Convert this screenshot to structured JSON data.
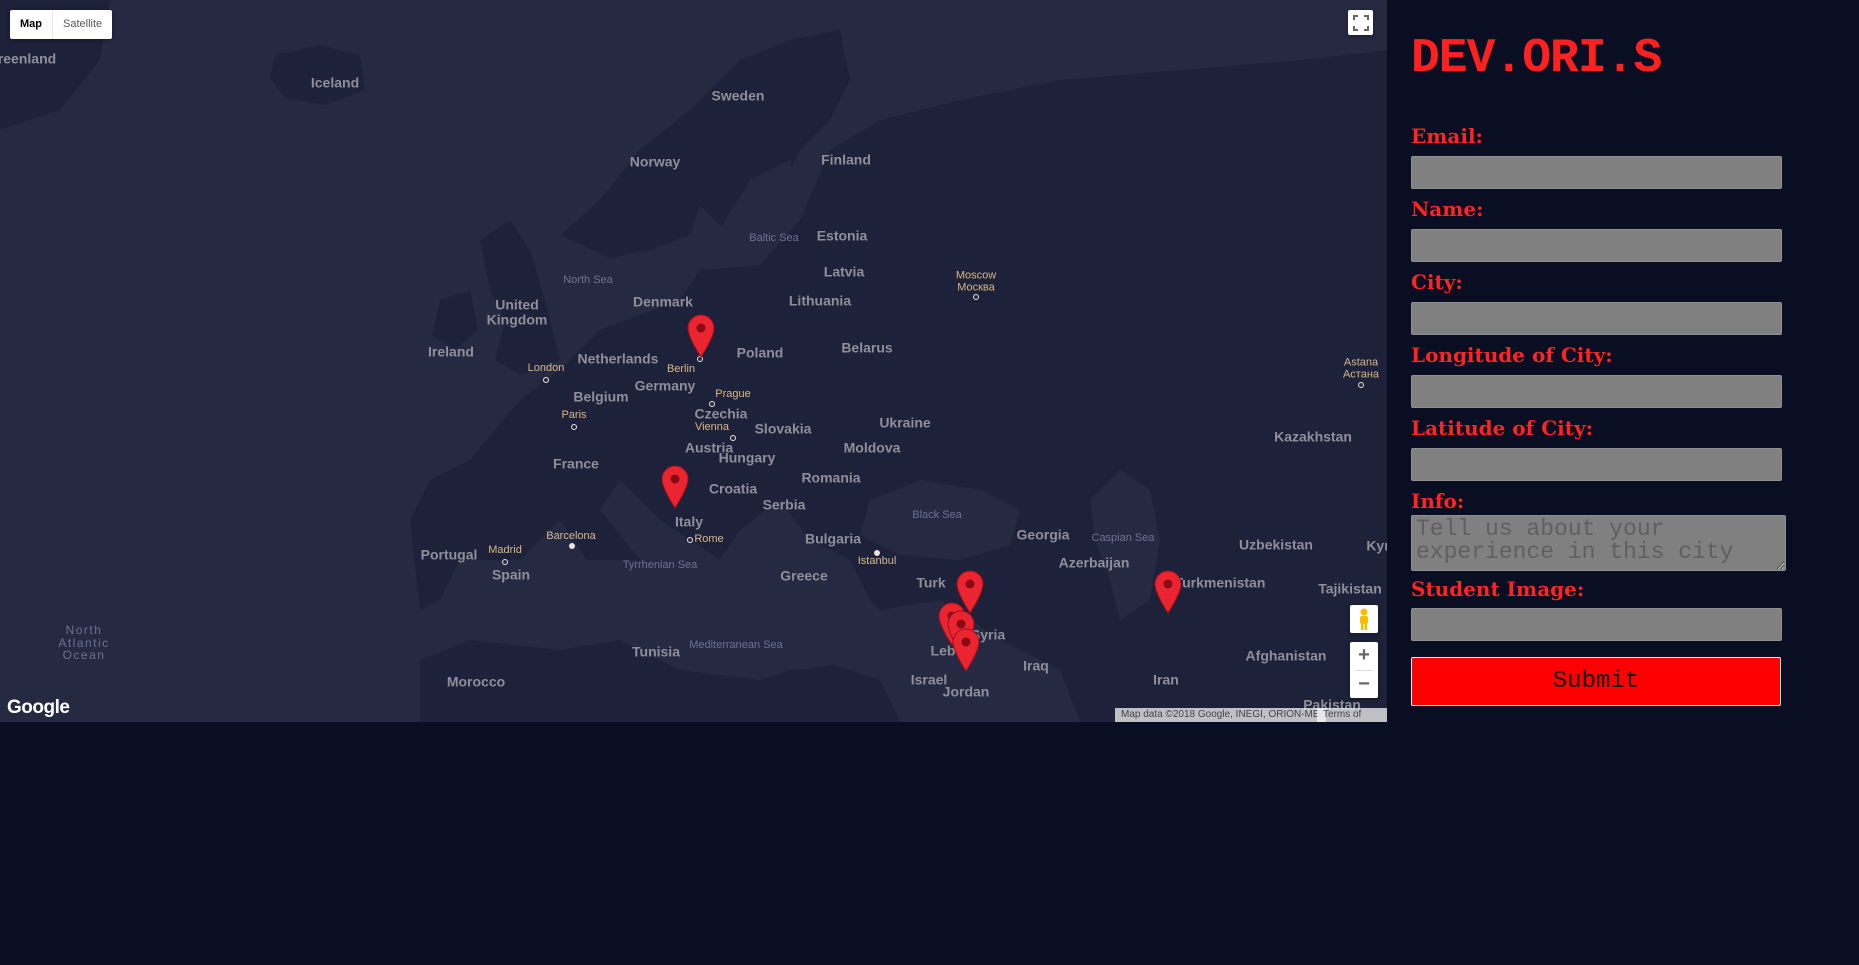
{
  "map": {
    "type_control": {
      "map_label": "Map",
      "satellite_label": "Satellite"
    },
    "fullscreen_icon": "fullscreen-icon",
    "pegman_icon": "pegman-icon",
    "zoom_in_label": "+",
    "zoom_out_label": "−",
    "logo": "Google",
    "attribution": "Map data ©2018 Google, INEGI, ORION-ME",
    "terms": "Terms of Use",
    "labels": [
      {
        "text": "reenland",
        "kind": "country"
      },
      {
        "text": "Iceland",
        "kind": "country"
      },
      {
        "text": "Sweden",
        "kind": "country"
      },
      {
        "text": "Norway",
        "kind": "country"
      },
      {
        "text": "Finland",
        "kind": "country"
      },
      {
        "text": "Baltic Sea",
        "kind": "sea"
      },
      {
        "text": "Estonia",
        "kind": "country"
      },
      {
        "text": "North Sea",
        "kind": "sea"
      },
      {
        "text": "Latvia",
        "kind": "country"
      },
      {
        "text": "Moscow\nМосква",
        "kind": "city"
      },
      {
        "text": "Denmark",
        "kind": "country"
      },
      {
        "text": "Lithuania",
        "kind": "country"
      },
      {
        "text": "United\nKingdom",
        "kind": "country"
      },
      {
        "text": "Ireland",
        "kind": "country"
      },
      {
        "text": "Belarus",
        "kind": "country"
      },
      {
        "text": "Netherlands",
        "kind": "country"
      },
      {
        "text": "Poland",
        "kind": "country"
      },
      {
        "text": "Berlin",
        "kind": "city"
      },
      {
        "text": "London",
        "kind": "city"
      },
      {
        "text": "Astana\nАстана",
        "kind": "city"
      },
      {
        "text": "Germany",
        "kind": "country"
      },
      {
        "text": "Belgium",
        "kind": "country"
      },
      {
        "text": "Prague",
        "kind": "city"
      },
      {
        "text": "Paris",
        "kind": "city"
      },
      {
        "text": "Czechia",
        "kind": "country"
      },
      {
        "text": "Ukraine",
        "kind": "country"
      },
      {
        "text": "Vienna",
        "kind": "city"
      },
      {
        "text": "Slovakia",
        "kind": "country"
      },
      {
        "text": "Kazakhstan",
        "kind": "country"
      },
      {
        "text": "Austria",
        "kind": "country"
      },
      {
        "text": "Moldova",
        "kind": "country"
      },
      {
        "text": "Hungary",
        "kind": "country"
      },
      {
        "text": "France",
        "kind": "country"
      },
      {
        "text": "Romania",
        "kind": "country"
      },
      {
        "text": "Croatia",
        "kind": "country"
      },
      {
        "text": "Serbia",
        "kind": "country"
      },
      {
        "text": "Black Sea",
        "kind": "sea"
      },
      {
        "text": "Italy",
        "kind": "country"
      },
      {
        "text": "Georgia",
        "kind": "country"
      },
      {
        "text": "Barcelona",
        "kind": "city"
      },
      {
        "text": "Bulgaria",
        "kind": "country"
      },
      {
        "text": "Caspian Sea",
        "kind": "sea"
      },
      {
        "text": "Rome",
        "kind": "city"
      },
      {
        "text": "Uzbekistan",
        "kind": "country"
      },
      {
        "text": "Kyr",
        "kind": "country"
      },
      {
        "text": "Portugal",
        "kind": "country"
      },
      {
        "text": "Madrid",
        "kind": "city"
      },
      {
        "text": "Istanbul",
        "kind": "city"
      },
      {
        "text": "Azerbaijan",
        "kind": "country"
      },
      {
        "text": "Tyrrhenian Sea",
        "kind": "sea"
      },
      {
        "text": "Spain",
        "kind": "country"
      },
      {
        "text": "Greece",
        "kind": "country"
      },
      {
        "text": "Turkmenistan",
        "kind": "country"
      },
      {
        "text": "Turk",
        "kind": "country"
      },
      {
        "text": "Tajikistan",
        "kind": "country"
      },
      {
        "text": "North\nAtlantic\nOcean",
        "kind": "ocean"
      },
      {
        "text": "Syria",
        "kind": "country"
      },
      {
        "text": "Leb",
        "kind": "country"
      },
      {
        "text": "Tunisia",
        "kind": "country"
      },
      {
        "text": "Mediterranean Sea",
        "kind": "sea"
      },
      {
        "text": "Afghanistan",
        "kind": "country"
      },
      {
        "text": "Iraq",
        "kind": "country"
      },
      {
        "text": "Israel",
        "kind": "country"
      },
      {
        "text": "Iran",
        "kind": "country"
      },
      {
        "text": "Morocco",
        "kind": "country"
      },
      {
        "text": "Jordan",
        "kind": "country"
      },
      {
        "text": "Pakistan",
        "kind": "country"
      }
    ],
    "markers": [
      {
        "place": "Berlin"
      },
      {
        "place": "Italy"
      },
      {
        "place": "Turkey"
      },
      {
        "place": "Lebanon"
      },
      {
        "place": "Lebanon"
      },
      {
        "place": "Lebanon"
      },
      {
        "place": "Turkmenistan"
      }
    ]
  },
  "form": {
    "brand": "DEV.ORI.S",
    "email_label": "Email:",
    "name_label": "Name:",
    "city_label": "City:",
    "longitude_label": "Longitude of City:",
    "latitude_label": "Latitude of City:",
    "info_label": "Info:",
    "info_placeholder": "Tell us about your experience in this city",
    "image_label": "Student Image:",
    "submit_label": "Submit"
  },
  "colors": {
    "page_background": "#0a0e22",
    "map_water": "#252a42",
    "map_land": "#1c2038",
    "accent_red": "#ff0000",
    "input_gray": "#808080"
  }
}
